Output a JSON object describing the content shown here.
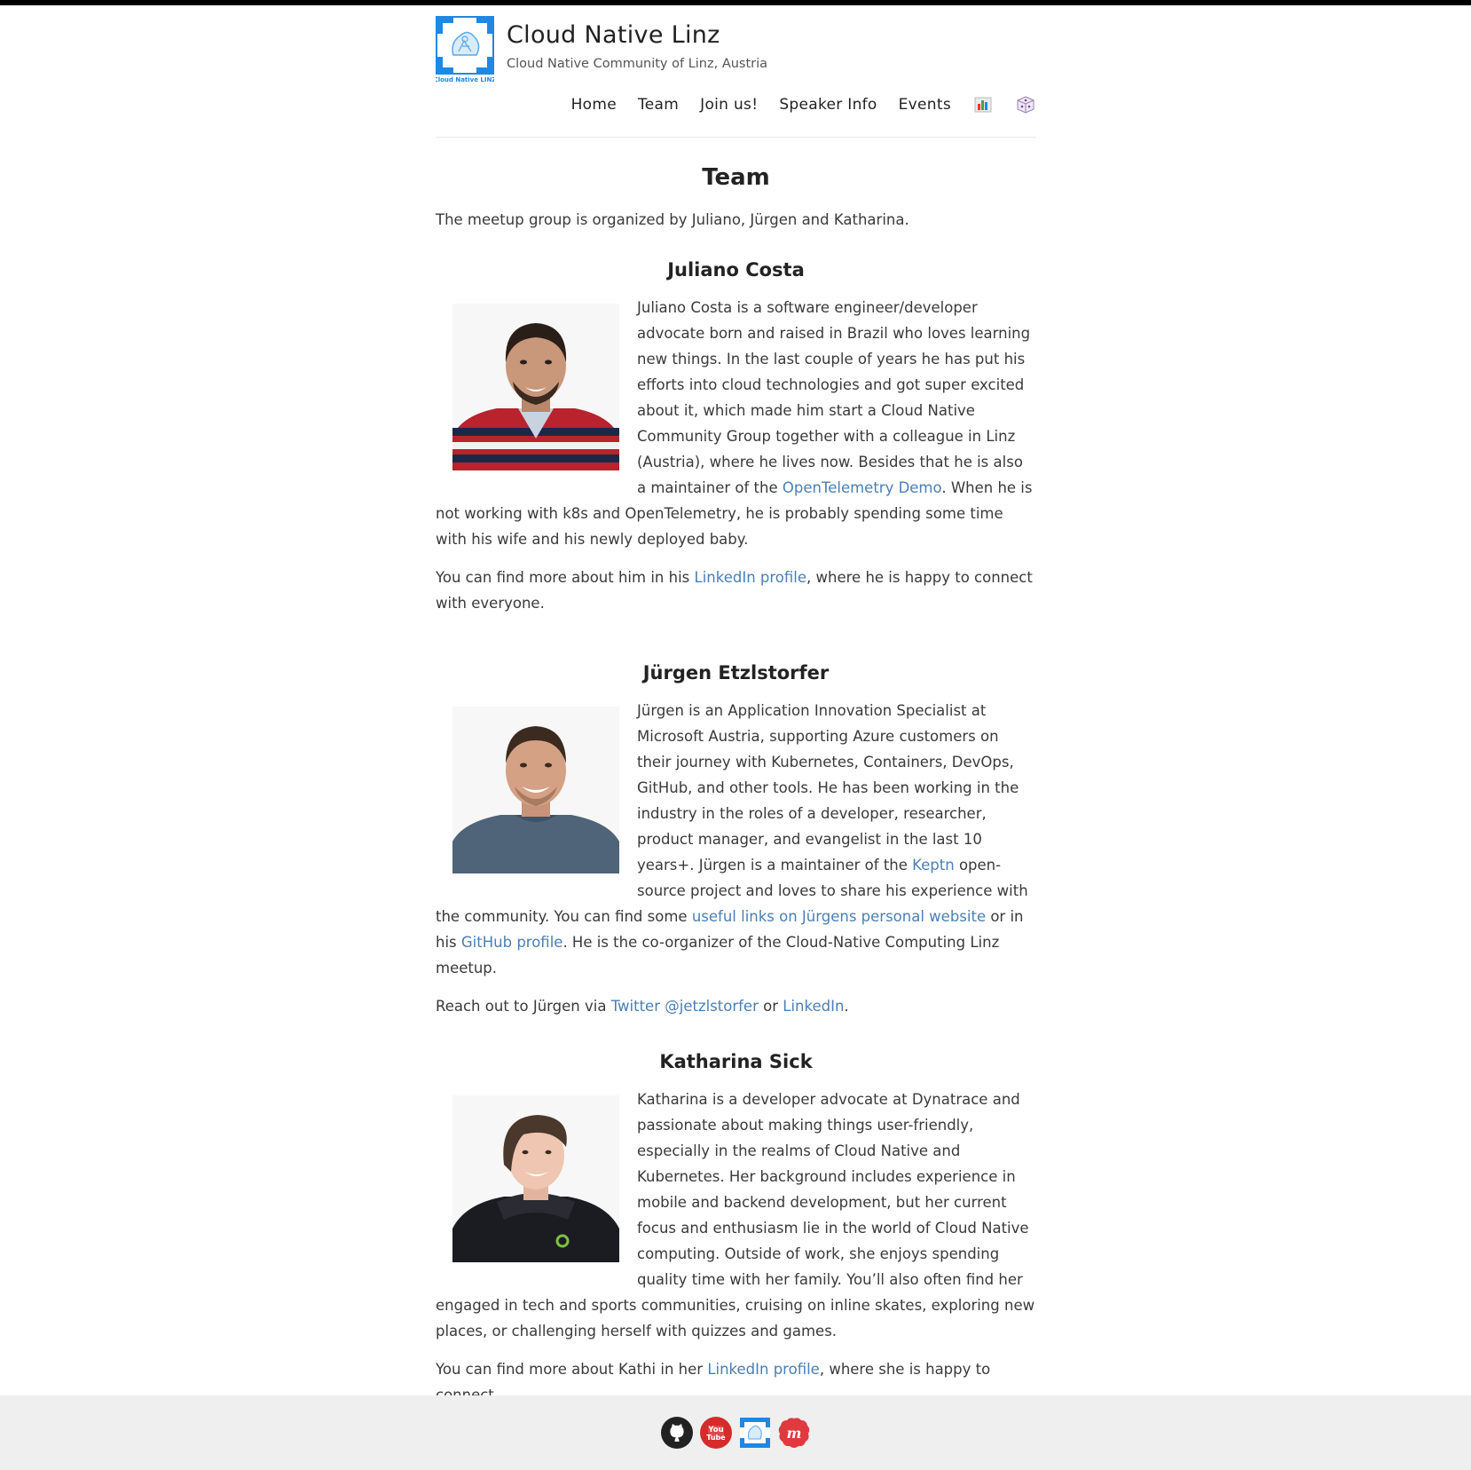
{
  "site": {
    "title": "Cloud Native Linz",
    "subtitle": "Cloud Native Community of Linz, Austria",
    "logo_icon": "cloud-native-linz-logo",
    "logo_text": "Cloud Native LINZ"
  },
  "nav": {
    "items": [
      "Home",
      "Team",
      "Join us!",
      "Speaker Info",
      "Events"
    ],
    "extra_icons": [
      "bar-chart-icon",
      "dice-icon"
    ]
  },
  "page": {
    "title": "Team",
    "intro": "The meetup group is organized by Juliano, Jürgen and Katharina."
  },
  "people": [
    {
      "name": "Juliano Costa",
      "bio_1": "Juliano Costa is a software engineer/developer advocate born and raised in Brazil who loves learning new things. In the last couple of years he has put his efforts into cloud technologies and got super excited about it, which made him start a Cloud Native Community Group together with a colleague in Linz (Austria), where he lives now. Besides that he is also a maintainer of the ",
      "link_1": "OpenTelemetry Demo",
      "bio_2": ". When he is not working with k8s and OpenTelemetry, he is probably spending some time with his wife and his newly deployed baby.",
      "more_1": "You can find more about him in his ",
      "more_link": "LinkedIn profile",
      "more_2": ", where he is happy to connect with everyone."
    },
    {
      "name": "Jürgen Etzlstorfer",
      "bio_1": "Jürgen is an Application Innovation Specialist at Microsoft Austria, supporting Azure customers on their journey with Kubernetes, Containers, DevOps, GitHub, and other tools. He has been working in the industry in the roles of a developer, researcher, product manager, and evangelist in the last 10 years+. Jürgen is a maintainer of the ",
      "link_1": "Keptn",
      "bio_2": " open-source project and loves to share his experience with the community. You can find some ",
      "link_2": "useful links on Jürgens personal website",
      "bio_3": " or in his ",
      "link_3": "GitHub profile",
      "bio_4": ". He is the co-organizer of the Cloud-Native Computing Linz meetup.",
      "more_1": "Reach out to Jürgen via ",
      "more_link": "Twitter @jetzlstorfer",
      "more_2": " or ",
      "more_link_2": "LinkedIn",
      "more_3": "."
    },
    {
      "name": "Katharina Sick",
      "bio_1": "Katharina is a developer advocate at Dynatrace and passionate about making things user-friendly, especially in the realms of Cloud Native and Kubernetes. Her background includes experience in mobile and backend development, but her current focus and enthusiasm lie in the world of Cloud Native computing. Outside of work, she enjoys spending quality time with her family. You’ll also often find her engaged in tech and sports communities, cruising on inline skates, exploring new places, or challenging herself with quizzes and games.",
      "more_1": "You can find more about Kathi in her ",
      "more_link": "LinkedIn profile",
      "more_2": ", where she is happy to connect."
    }
  ],
  "footer": {
    "icons": [
      "github-icon",
      "youtube-icon",
      "cncf-icon",
      "meetup-icon"
    ],
    "youtube_text": "You Tube",
    "meetup_text": "m"
  },
  "colors": {
    "link": "#4a7fb5",
    "text": "#3a3a3a",
    "footer_bg": "#efefef",
    "logo_blue": "#1e88e5"
  }
}
